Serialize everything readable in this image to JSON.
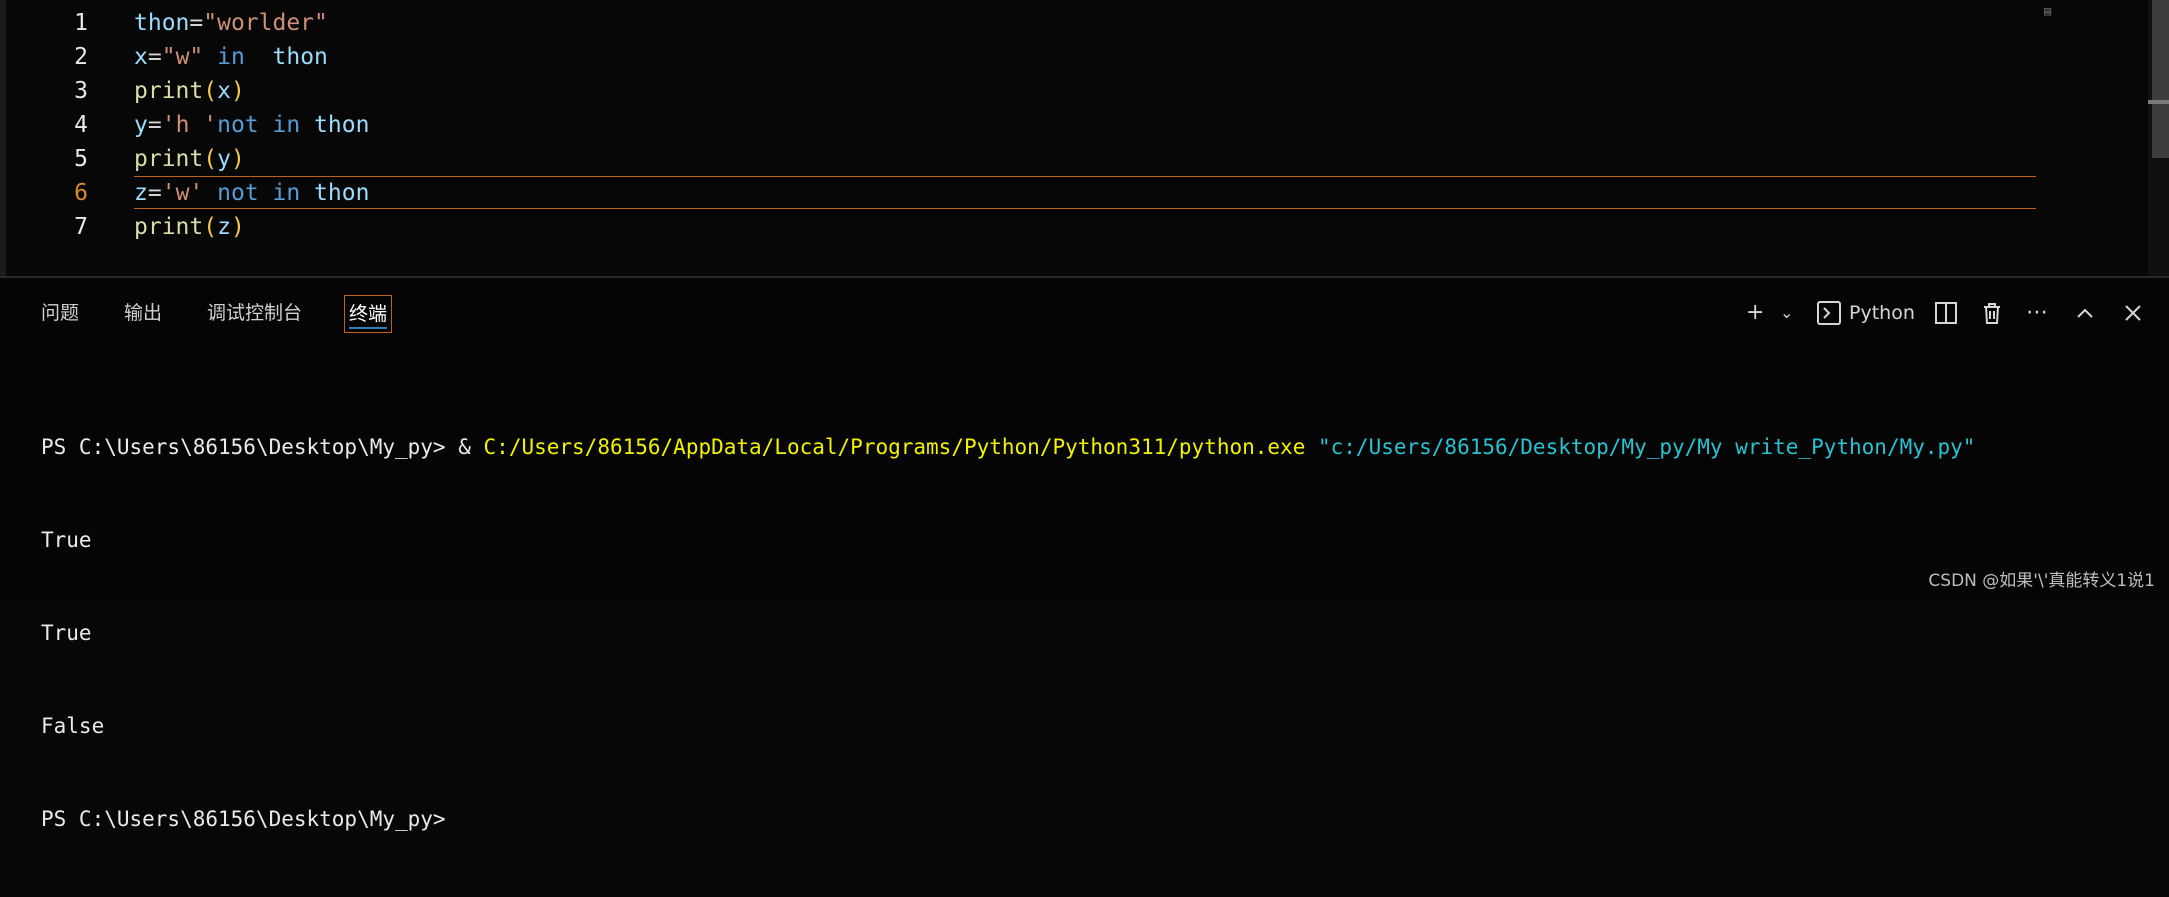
{
  "editor": {
    "lines": [
      {
        "number": "1",
        "tokens": [
          {
            "t": "thon",
            "c": "var"
          },
          {
            "t": "=",
            "c": "op"
          },
          {
            "t": "\"worlder\"",
            "c": "str"
          }
        ]
      },
      {
        "number": "2",
        "tokens": [
          {
            "t": "x",
            "c": "var"
          },
          {
            "t": "=",
            "c": "op"
          },
          {
            "t": "\"w\"",
            "c": "str"
          },
          {
            "t": " in  ",
            "c": "kw"
          },
          {
            "t": "thon",
            "c": "var"
          }
        ]
      },
      {
        "number": "3",
        "tokens": [
          {
            "t": "print",
            "c": "fn"
          },
          {
            "t": "(",
            "c": "paren"
          },
          {
            "t": "x",
            "c": "var"
          },
          {
            "t": ")",
            "c": "paren"
          }
        ]
      },
      {
        "number": "4",
        "tokens": [
          {
            "t": "y",
            "c": "var"
          },
          {
            "t": "=",
            "c": "op"
          },
          {
            "t": "'h '",
            "c": "str"
          },
          {
            "t": "not in ",
            "c": "kw"
          },
          {
            "t": "thon",
            "c": "var"
          }
        ]
      },
      {
        "number": "5",
        "tokens": [
          {
            "t": "print",
            "c": "fn"
          },
          {
            "t": "(",
            "c": "paren"
          },
          {
            "t": "y",
            "c": "var"
          },
          {
            "t": ")",
            "c": "paren"
          }
        ]
      },
      {
        "number": "6",
        "active": true,
        "tokens": [
          {
            "t": "z",
            "c": "var"
          },
          {
            "t": "=",
            "c": "op"
          },
          {
            "t": "'w'",
            "c": "str"
          },
          {
            "t": " not in ",
            "c": "kw"
          },
          {
            "t": "thon",
            "c": "var"
          }
        ]
      },
      {
        "number": "7",
        "tokens": [
          {
            "t": "print",
            "c": "fn"
          },
          {
            "t": "(",
            "c": "paren"
          },
          {
            "t": "z",
            "c": "var"
          },
          {
            "t": ")",
            "c": "paren"
          }
        ]
      }
    ]
  },
  "panel": {
    "tabs": {
      "problems": "问题",
      "output": "输出",
      "debug_console": "调试控制台",
      "terminal": "终端"
    },
    "toolbar": {
      "terminal_profile": "Python"
    }
  },
  "terminal": {
    "prompt": "PS C:\\Users\\86156\\Desktop\\My_py> ",
    "amp": "& ",
    "exe_path": "C:/Users/86156/AppData/Local/Programs/Python/Python311/python.exe",
    "script_path": "\"c:/Users/86156/Desktop/My_py/My write_Python/My.py\"",
    "output_lines": [
      "True",
      "True",
      "False"
    ],
    "final_prompt": "PS C:\\Users\\86156\\Desktop\\My_py>"
  },
  "watermark": "CSDN @如果'\\'真能转义1说1",
  "colors": {
    "accent_orange": "#c0601d",
    "active_tab_underline": "#2f7fbf"
  }
}
